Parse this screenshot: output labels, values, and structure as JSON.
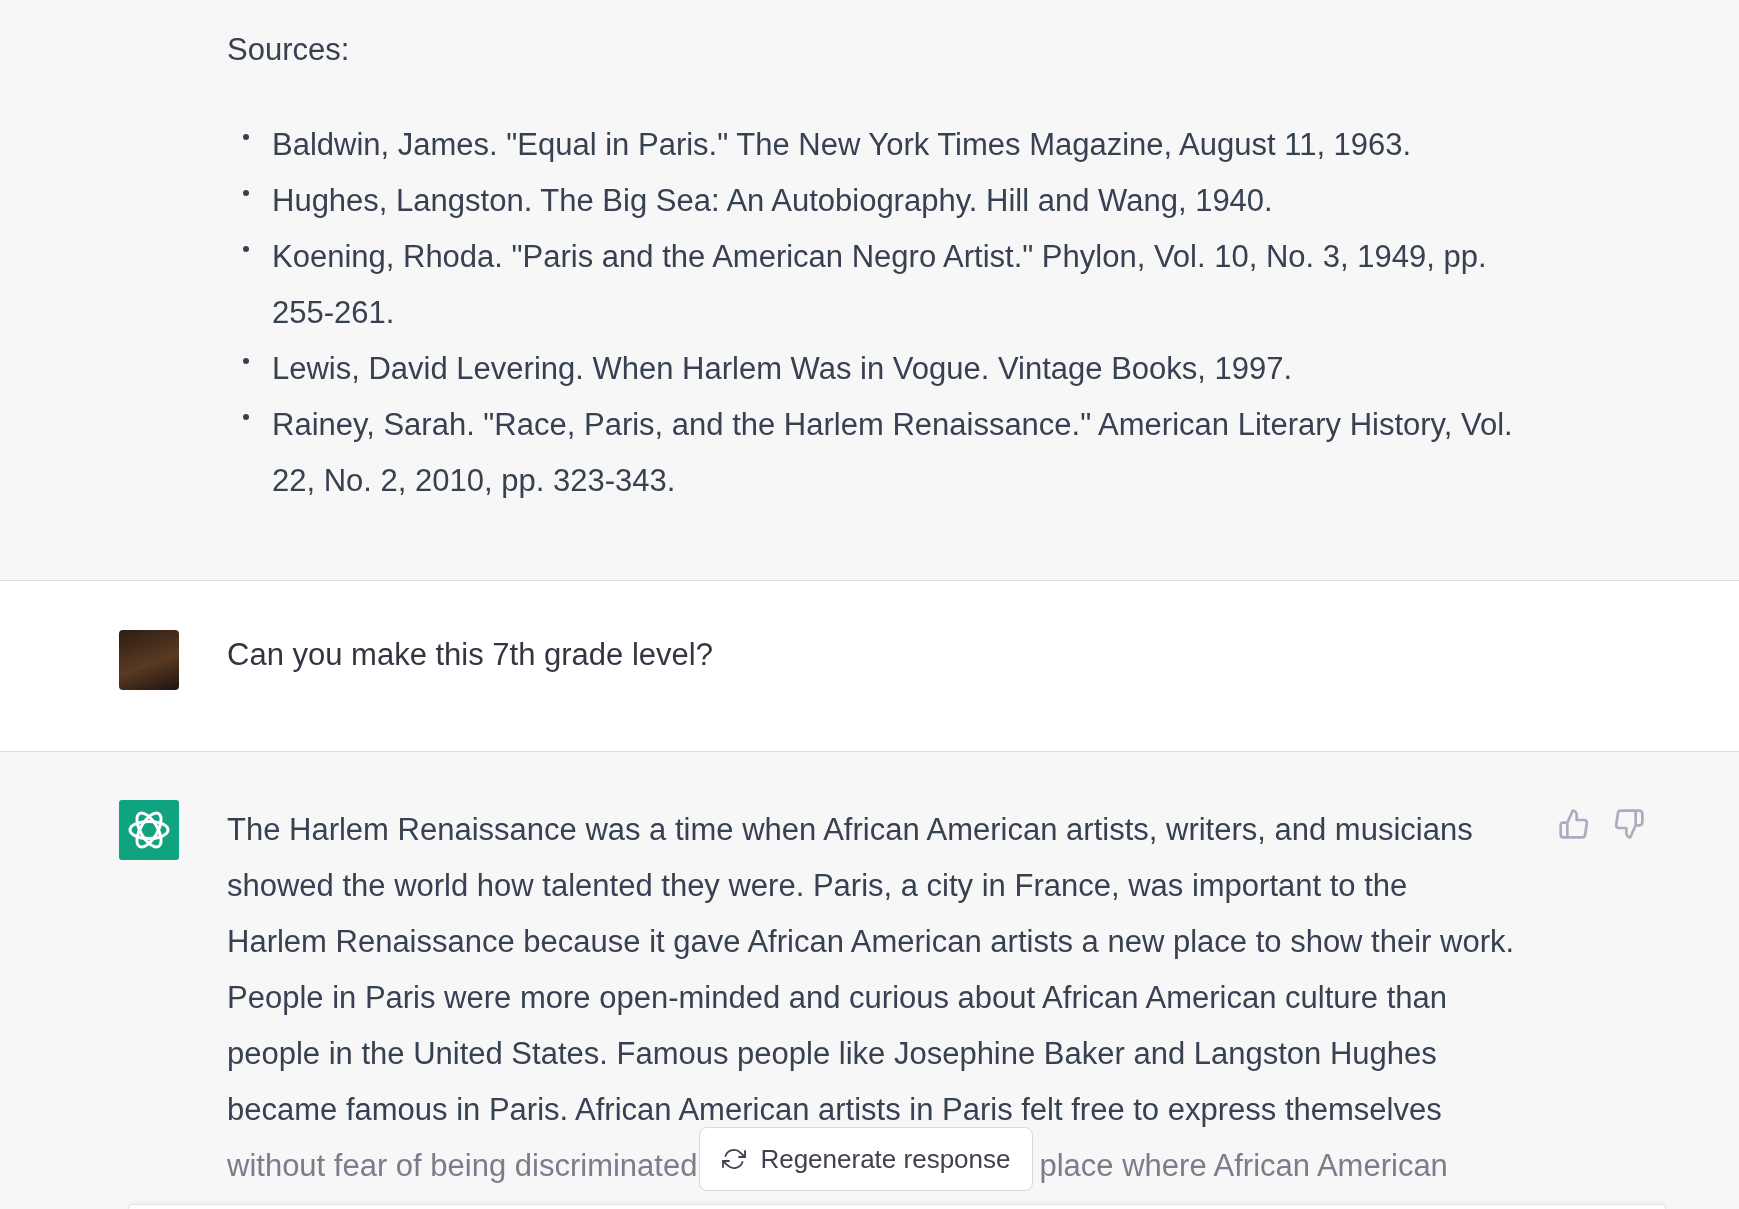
{
  "sources": {
    "heading": "Sources:",
    "items": [
      {
        "lines": [
          "Baldwin, James. \"Equal in Paris.\" The New York Times Magazine, August 11, 1963."
        ]
      },
      {
        "lines": [
          "Hughes, Langston. The Big Sea: An Autobiography. Hill and Wang, 1940."
        ]
      },
      {
        "lines": [
          "Koening, Rhoda. \"Paris and the American Negro Artist.\" Phylon, Vol. 10, No. 3, 1949, pp.",
          "255-261."
        ]
      },
      {
        "lines": [
          "Lewis, David Levering. When Harlem Was in Vogue. Vintage Books, 1997."
        ]
      },
      {
        "lines": [
          "Rainey, Sarah. \"Race, Paris, and the Harlem Renaissance.\" American Literary History, Vol.",
          "22, No. 2, 2010, pp. 323-343."
        ]
      }
    ]
  },
  "user_message": {
    "text": "Can you make this 7th grade level?"
  },
  "assistant_message": {
    "lines": [
      "The Harlem Renaissance was a time when African American artists, writers, and musicians",
      "showed the world how talented they were. Paris, a city in France, was important to the",
      "Harlem Renaissance because it gave African American artists a new place to show their work.",
      "People in Paris were more open-minded and curious about African American culture than",
      "people in the United States. Famous people like Josephine Baker and Langston Hughes",
      "became famous in Paris. African American artists in Paris felt free to express themselves"
    ],
    "last_line": {
      "before": "without fear of being discriminated",
      "after": "place where African American"
    }
  },
  "regenerate_button": {
    "label": "Regenerate response"
  }
}
